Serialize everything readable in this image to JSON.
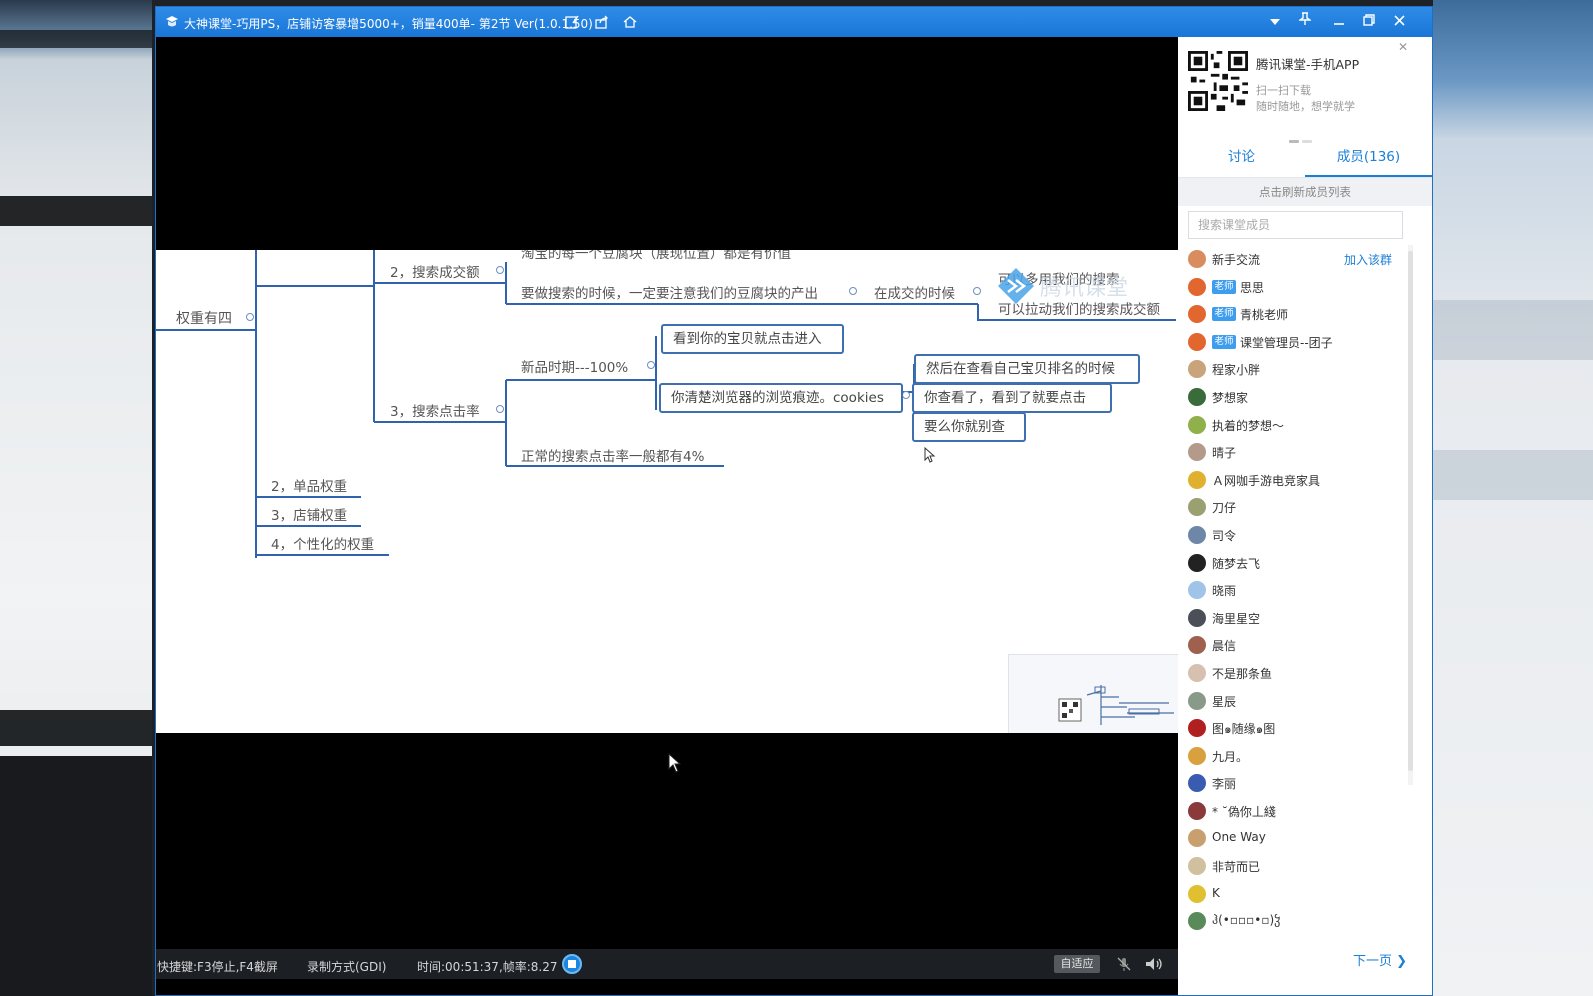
{
  "window": {
    "title": "大神课堂-巧用PS，店铺访客暴增5000+，销量400单- 第2节 Ver(1.0.1.50)",
    "accent": "#1a76d6"
  },
  "mindmap": {
    "root": "权重有四",
    "top_cut": "淘宝的每一个豆腐块（展现位置）都是有价值",
    "n2": "2，搜索成交额",
    "n2a": "要做搜索的时候，一定要注意我们的豆腐块的产出",
    "n2b": "在成交的时候",
    "n2c1": "可以多用我们的搜索",
    "n2c2": "可以拉动我们的搜索成交额",
    "n3": "3，搜索点击率",
    "n3a": "新品时期---100%",
    "n3a1": "看到你的宝贝就点击进入",
    "n3a2": "你清楚浏览器的浏览痕迹。cookies",
    "n3a2a": "然后在查看自己宝贝排名的时候",
    "n3a2b": "你查看了，看到了就要点击",
    "n3a2c": "要么你就别查",
    "n3b": "正常的搜索点击率一般都有4%",
    "s2": "2，单品权重",
    "s3": "3，店铺权重",
    "s4": "4，个性化的权重",
    "watermark": "腾讯课堂"
  },
  "status": {
    "hotkeys": "快捷键:F3停止,F4截屏",
    "mode": "录制方式(GDI)",
    "time": "时间:00:51:37,帧率:8.27",
    "fit": "自适应"
  },
  "panel": {
    "promo_title": "腾讯课堂-手机APP",
    "promo_sub1": "扫一扫下载",
    "promo_sub2": "随时随地，想学就学",
    "tab_discuss": "讨论",
    "tab_members": "成员(136)",
    "refresh": "点击刷新成员列表",
    "search_placeholder": "搜索课堂成员",
    "join": "加入该群",
    "teacher_badge": "老师",
    "next_page": "下一页",
    "members": [
      {
        "name": "新手交流",
        "color": "#d98c5f"
      },
      {
        "name": "思思",
        "color": "#e2672f",
        "teacher": true
      },
      {
        "name": "青桃老师",
        "color": "#e2672f",
        "teacher": true
      },
      {
        "name": "课堂管理员--团子",
        "color": "#e2672f",
        "teacher": true
      },
      {
        "name": "程家小胖",
        "color": "#c9a37a"
      },
      {
        "name": "梦想家",
        "color": "#3a6b3a"
      },
      {
        "name": "执着的梦想～",
        "color": "#8fb04a"
      },
      {
        "name": "晴子",
        "color": "#b49a8a"
      },
      {
        "name": "Ａ网咖手游电竞家具",
        "color": "#e0b030"
      },
      {
        "name": "刀仔",
        "color": "#9aa070"
      },
      {
        "name": "司令",
        "color": "#6e86a8"
      },
      {
        "name": "随梦去飞",
        "color": "#222222"
      },
      {
        "name": "晓雨",
        "color": "#9fc4e8"
      },
      {
        "name": "海里星空",
        "color": "#4a4f58"
      },
      {
        "name": "晨信",
        "color": "#a06050"
      },
      {
        "name": "不是那条鱼",
        "color": "#d8c0b0"
      },
      {
        "name": "星辰",
        "color": "#8a9a8a"
      },
      {
        "name": "图๑随缘๑图",
        "color": "#b02020"
      },
      {
        "name": "九月。",
        "color": "#d9a040"
      },
      {
        "name": "李丽",
        "color": "#3a5cb0"
      },
      {
        "name": "* ˘偽你丄綫",
        "color": "#8a3a3a"
      },
      {
        "name": "One Way",
        "color": "#c8a070"
      },
      {
        "name": "非苛而已",
        "color": "#d0c0a0"
      },
      {
        "name": "K",
        "color": "#e0c030"
      },
      {
        "name": "ჰ(•▫▫▫•▫)ჴ",
        "color": "#5a8a5a"
      }
    ]
  }
}
